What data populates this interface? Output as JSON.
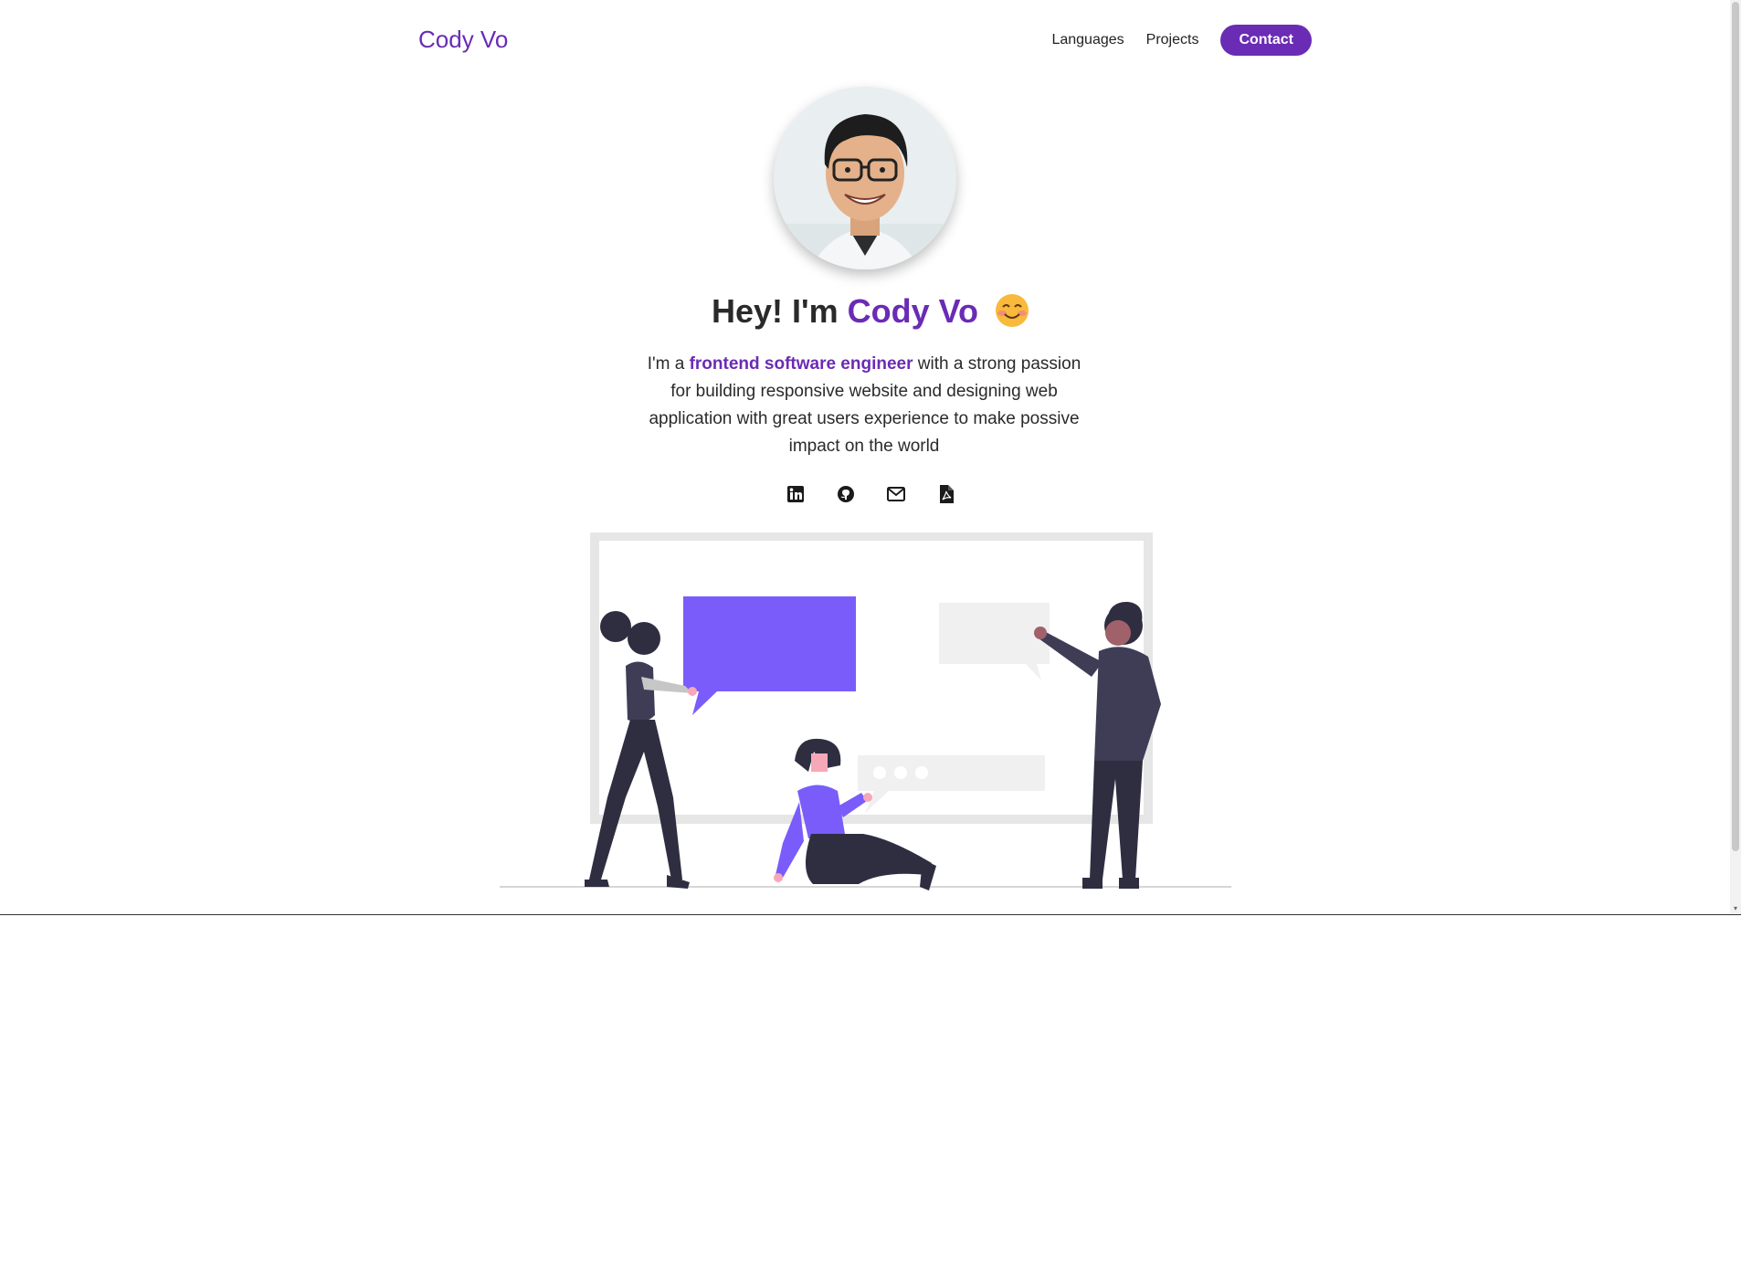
{
  "brand": "Cody Vo",
  "nav": {
    "items": [
      {
        "label": "Languages"
      },
      {
        "label": "Projects"
      }
    ],
    "contact_label": "Contact"
  },
  "hero": {
    "greeting": "Hey! I'm",
    "name": "Cody Vo",
    "intro_prefix": "I'm a",
    "intro_highlight": "frontend software engineer",
    "intro_rest": "with a strong passion for building responsive website and designing web application with great users experience to make possive impact on the world"
  },
  "social_icons": [
    "linkedin-icon",
    "github-icon",
    "email-icon",
    "pdf-resume-icon"
  ],
  "colors": {
    "accent": "#6a2bb5",
    "illustration_purple": "#7a5cfa",
    "figure_dark": "#2f2e41"
  }
}
